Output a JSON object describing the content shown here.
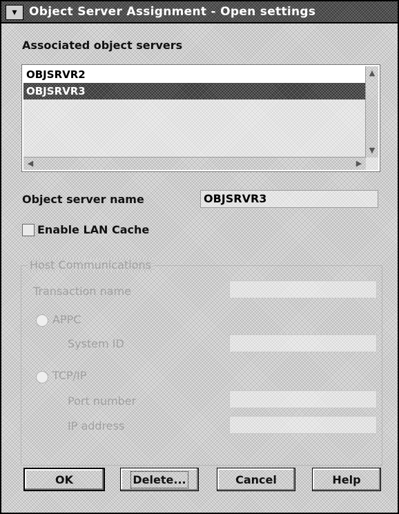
{
  "window": {
    "title": "Object Server Assignment - Open settings",
    "system_menu_icon": "system-menu-icon"
  },
  "associated": {
    "label": "Associated object servers",
    "items": [
      "OBJSRVR2",
      "OBJSRVR3"
    ],
    "selected": "OBJSRVR3"
  },
  "server_name": {
    "label": "Object server name",
    "value": "OBJSRVR3"
  },
  "lan_cache": {
    "label": "Enable LAN Cache",
    "checked": false
  },
  "host": {
    "group_label": "Host Communications",
    "transaction_label": "Transaction name",
    "transaction_value": "",
    "appc_label": "APPC",
    "system_id_label": "System ID",
    "system_id_value": "",
    "tcpip_label": "TCP/IP",
    "port_label": "Port number",
    "port_value": "",
    "ip_label": "IP address",
    "ip_value": ""
  },
  "buttons": {
    "ok": "OK",
    "delete": "Delete...",
    "cancel": "Cancel",
    "help": "Help"
  }
}
